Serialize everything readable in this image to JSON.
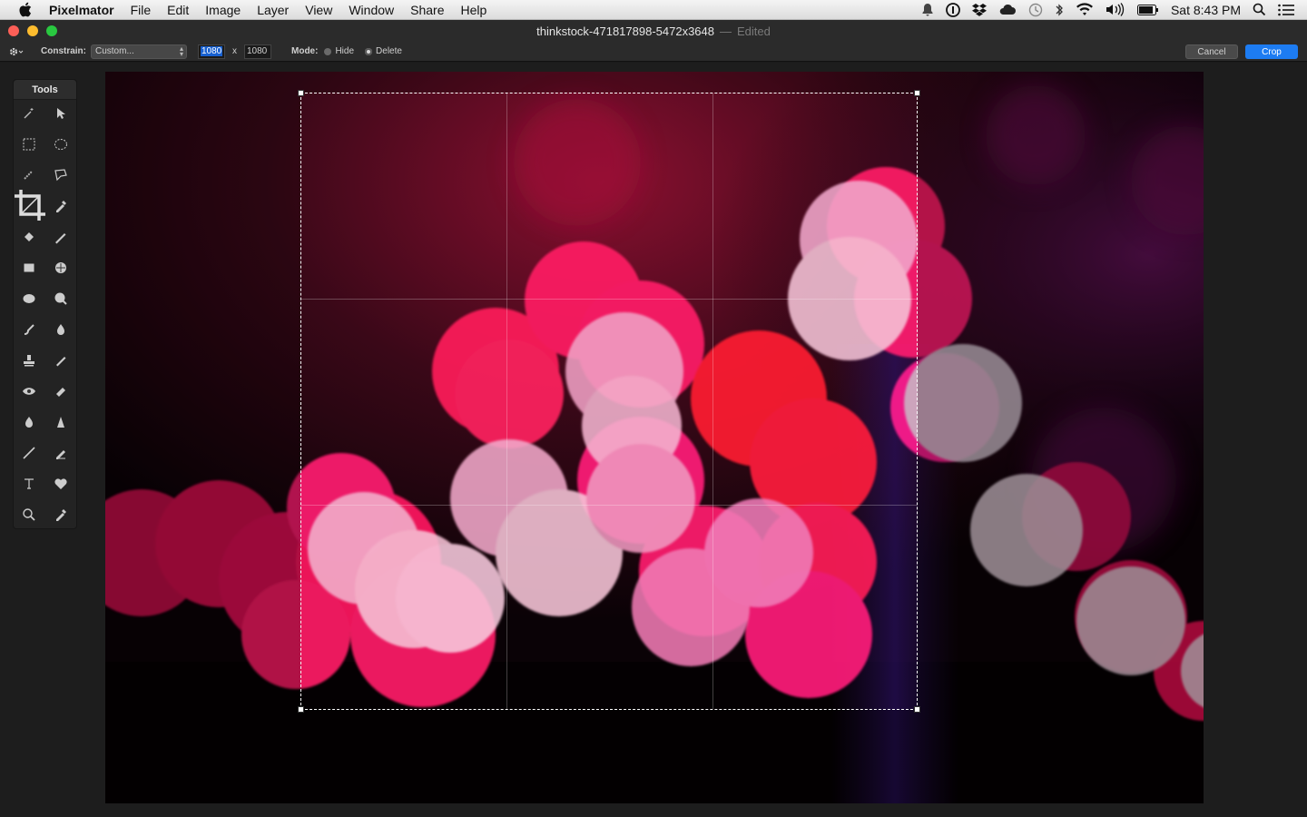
{
  "menubar": {
    "app_name": "Pixelmator",
    "items": [
      "File",
      "Edit",
      "Image",
      "Layer",
      "View",
      "Window",
      "Share",
      "Help"
    ],
    "clock": "Sat 8:43 PM"
  },
  "window": {
    "title": "thinkstock-471817898-5472x3648",
    "separator": "—",
    "edited_label": "Edited"
  },
  "options": {
    "constrain_label": "Constrain:",
    "constrain_value": "Custom...",
    "width_value": "1080",
    "times": "x",
    "height_value": "1080",
    "mode_label": "Mode:",
    "mode_hide": "Hide",
    "mode_delete": "Delete",
    "cancel_label": "Cancel",
    "crop_label": "Crop"
  },
  "tools": {
    "title": "Tools"
  },
  "colors": {
    "accent": "#1d7cf2",
    "bokeh_pink": "#ff1f6e",
    "bokeh_white": "#f3c4d6"
  }
}
